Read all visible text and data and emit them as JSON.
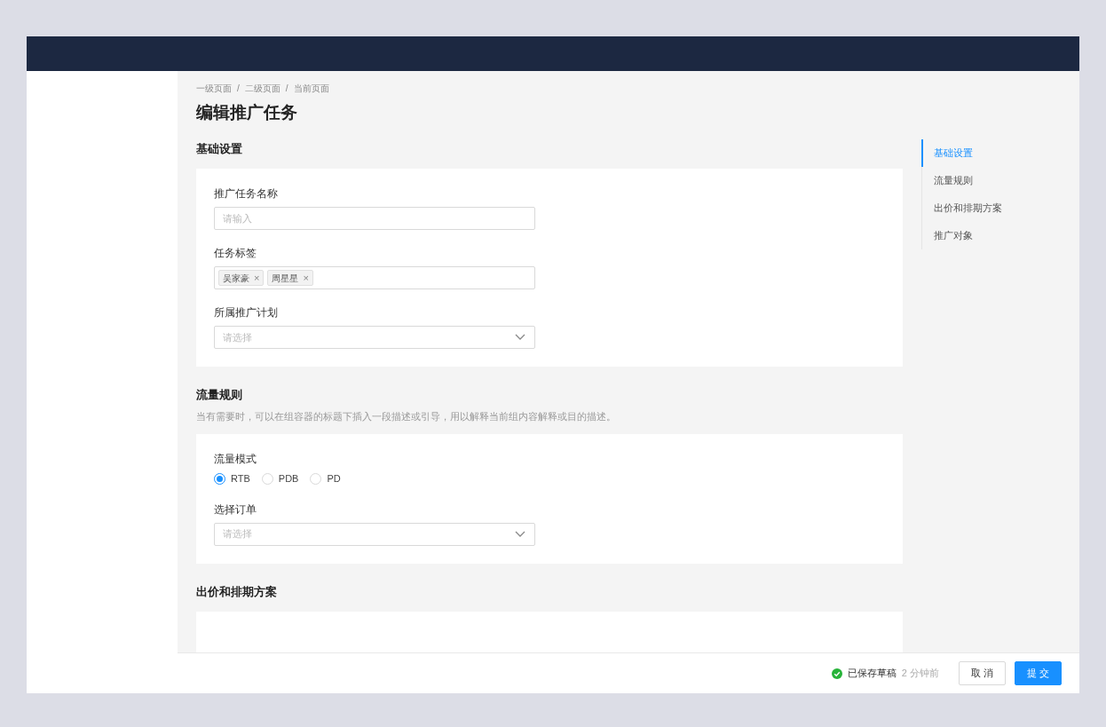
{
  "breadcrumb": [
    "一级页面",
    "二级页面",
    "当前页面"
  ],
  "breadcrumb_separator": "/",
  "page_title": "编辑推广任务",
  "sections": [
    {
      "title": "基础设置",
      "fields": [
        {
          "kind": "input",
          "label": "推广任务名称",
          "placeholder": "请输入"
        },
        {
          "kind": "tags",
          "label": "任务标签",
          "tags": [
            {
              "text": "吴家豪",
              "close": "×"
            },
            {
              "text": "周星星",
              "close": "×"
            }
          ]
        },
        {
          "kind": "select",
          "label": "所属推广计划",
          "placeholder": "请选择"
        }
      ]
    },
    {
      "title": "流量规则",
      "description": "当有需要时，可以在组容器的标题下插入一段描述或引导，用以解释当前组内容解释或目的描述。",
      "fields": [
        {
          "kind": "radio",
          "label": "流量模式",
          "options": [
            {
              "text": "RTB",
              "selected": true
            },
            {
              "text": "PDB",
              "selected": false
            },
            {
              "text": "PD",
              "selected": false
            }
          ]
        },
        {
          "kind": "select",
          "label": "选择订单",
          "placeholder": "请选择"
        }
      ]
    },
    {
      "title": "出价和排期方案"
    }
  ],
  "anchor_nav": [
    {
      "text": "基础设置",
      "selected": true
    },
    {
      "text": "流量规则",
      "selected": false
    },
    {
      "text": "出价和排期方案",
      "selected": false
    },
    {
      "text": "推广对象",
      "selected": false
    }
  ],
  "footer": {
    "save_status": "已保存草稿",
    "save_time": "2 分钟前",
    "buttons": [
      {
        "text": "取 消",
        "kind": "default"
      },
      {
        "text": "提 交",
        "kind": "primary"
      }
    ]
  }
}
